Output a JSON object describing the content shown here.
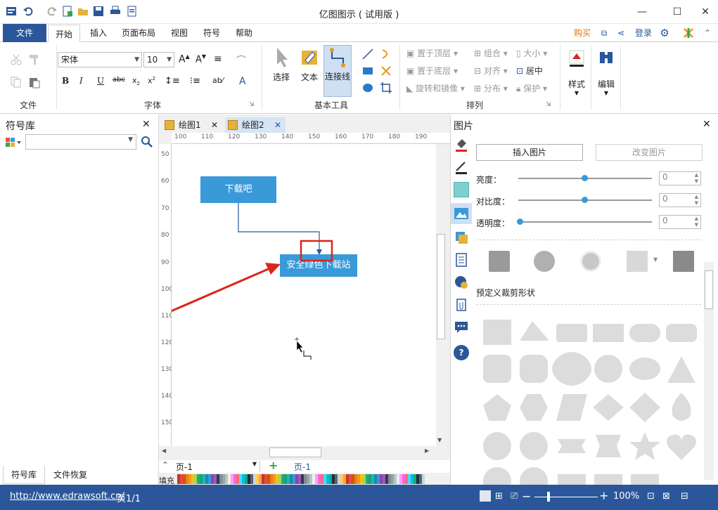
{
  "window": {
    "title": "亿图图示 ( 试用版 )"
  },
  "menu": {
    "file": "文件",
    "tabs": [
      "开始",
      "插入",
      "页面布局",
      "视图",
      "符号",
      "帮助"
    ],
    "buy": "购买",
    "login": "登录"
  },
  "ribbon": {
    "font_name": "宋体",
    "font_size": "10",
    "groups": {
      "file": "文件",
      "font": "字体",
      "basic_tools": "基本工具",
      "arrange": "排列"
    },
    "tools": {
      "select": "选择",
      "text": "文本",
      "connector": "连接线"
    },
    "arrange_items": {
      "bring_front": "置于顶层",
      "send_back": "置于底层",
      "rotate_mirror": "旋转和镜像",
      "group": "组合",
      "align": "对齐",
      "distribute": "分布",
      "size": "大小",
      "center": "居中",
      "protect": "保护"
    },
    "style": "样式",
    "edit": "编辑"
  },
  "left_panel": {
    "title": "符号库",
    "search_placeholder": "",
    "tab_library": "符号库",
    "tab_recovery": "文件恢复"
  },
  "documents": {
    "tabs": [
      "绘图1",
      "绘图2"
    ],
    "active": "绘图2"
  },
  "rulers": {
    "h": [
      "100",
      "110",
      "120",
      "130",
      "140",
      "150",
      "160",
      "170",
      "180",
      "190"
    ],
    "v": [
      "50",
      "60",
      "70",
      "80",
      "90",
      "100",
      "110",
      "120",
      "130",
      "140",
      "150"
    ]
  },
  "canvas": {
    "shape1": "下载吧",
    "shape2": "安全绿色下载站"
  },
  "page_bar": {
    "page_select": "页-1",
    "page_tab": "页-1",
    "fill_label": "填充"
  },
  "right_panel": {
    "title": "图片",
    "insert_image": "插入图片",
    "change_image": "改变图片",
    "brightness_label": "亮度：",
    "contrast_label": "对比度：",
    "transparency_label": "透明度：",
    "brightness": "0",
    "contrast": "0",
    "transparency": "0",
    "crop_label": "预定义裁剪形状"
  },
  "status": {
    "url": "http://www.edrawsoft.cn/",
    "page_info": "页1/1",
    "zoom": "100%"
  },
  "colors": {
    "brand_blue": "#2b579a",
    "shape_blue": "#3a9ad9",
    "annotation_red": "#d9261c"
  }
}
